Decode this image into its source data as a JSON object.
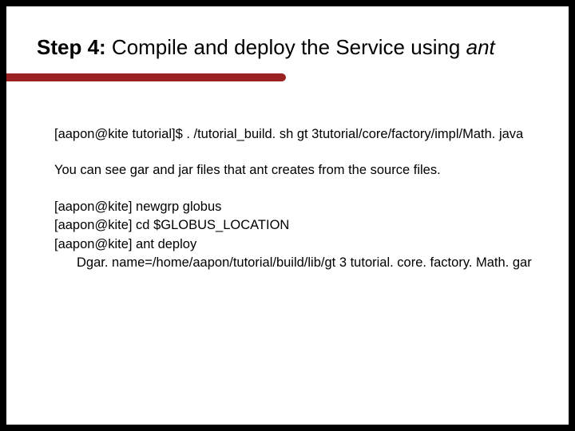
{
  "slide": {
    "title_bold": "Step 4:",
    "title_rest": "  Compile and deploy the Service using ",
    "title_italic": "ant"
  },
  "body": {
    "line1": "[aapon@kite tutorial]$ . /tutorial_build. sh gt 3tutorial/core/factory/impl/Math. java",
    "line2": "You can see gar and jar files that ant creates from the source files.",
    "cmd1": "[aapon@kite] newgrp globus",
    "cmd2": "[aapon@kite] cd $GLOBUS_LOCATION",
    "cmd3": "[aapon@kite] ant deploy",
    "cmd4": "Dgar. name=/home/aapon/tutorial/build/lib/gt 3 tutorial. core. factory. Math. gar"
  }
}
